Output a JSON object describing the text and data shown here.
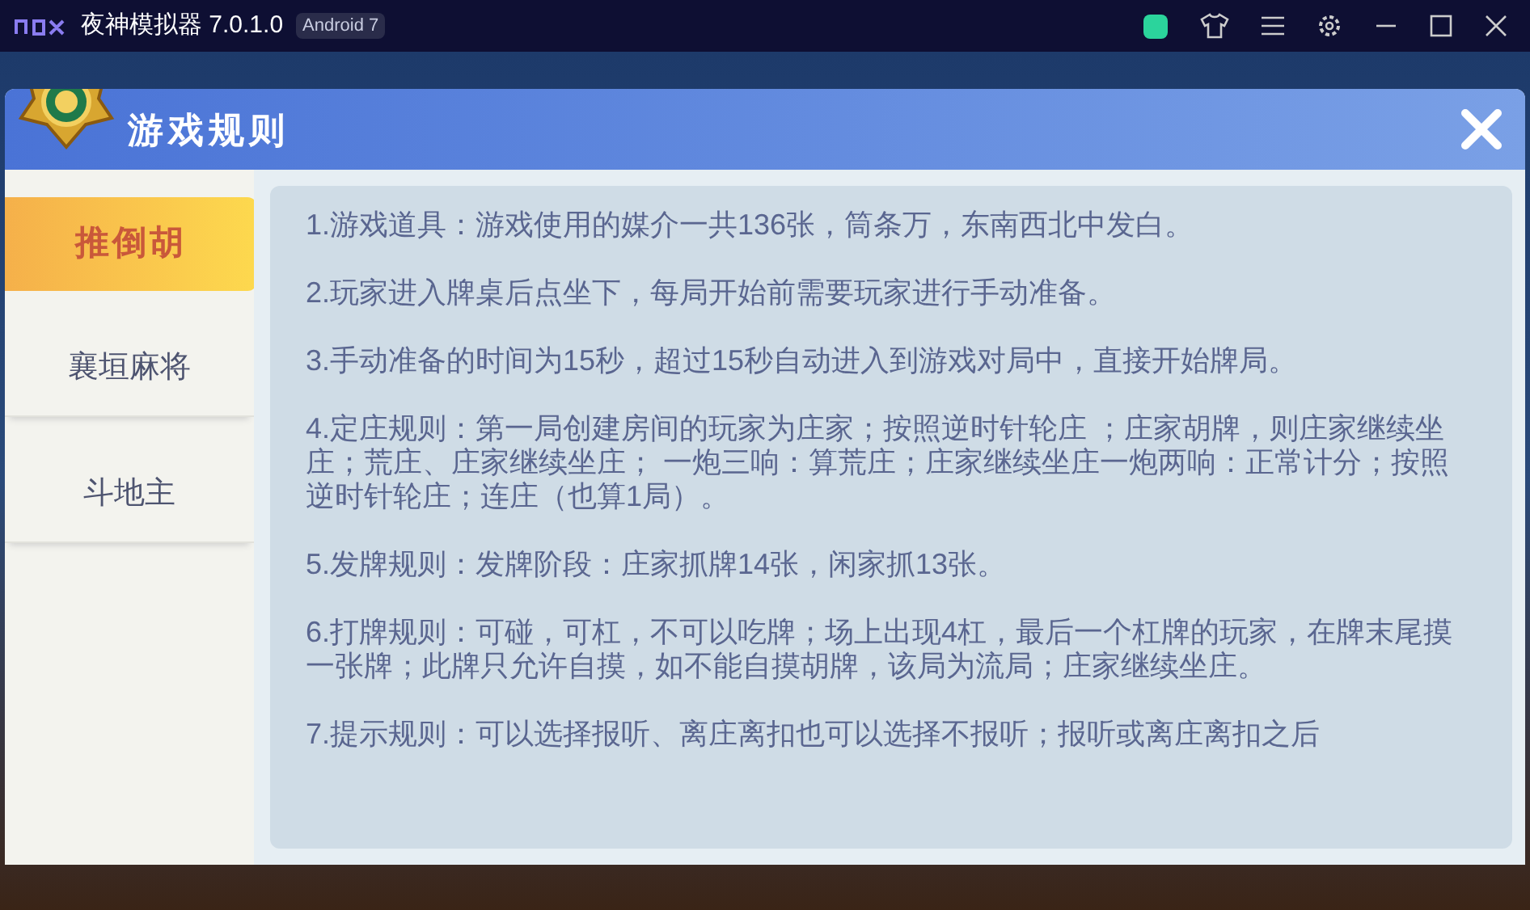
{
  "window": {
    "app_name": "夜神模拟器 7.0.1.0",
    "badge": "Android 7"
  },
  "dialog": {
    "title": "游戏规则"
  },
  "sidebar": {
    "items": [
      {
        "label": "推倒胡",
        "selected": true
      },
      {
        "label": "襄垣麻将",
        "selected": false
      },
      {
        "label": "斗地主",
        "selected": false
      }
    ]
  },
  "rules": [
    "1.游戏道具：游戏使用的媒介一共136张，筒条万，东南西北中发白。",
    "2.玩家进入牌桌后点坐下，每局开始前需要玩家进行手动准备。",
    "3.手动准备的时间为15秒，超过15秒自动进入到游戏对局中，直接开始牌局。",
    "4.定庄规则：第一局创建房间的玩家为庄家；按照逆时针轮庄 ；庄家胡牌，则庄家继续坐庄；荒庄、庄家继续坐庄；  一炮三响：算荒庄；庄家继续坐庄一炮两响：正常计分；按照逆时针轮庄；连庄（也算1局）。",
    "5.发牌规则：发牌阶段：庄家抓牌14张，闲家抓13张。",
    "6.打牌规则：可碰，可杠，不可以吃牌；场上出现4杠，最后一个杠牌的玩家，在牌末尾摸一张牌；此牌只允许自摸，如不能自摸胡牌，该局为流局；庄家继续坐庄。",
    "7.提示规则：可以选择报听、离庄离扣也可以选择不报听；报听或离庄离扣之后"
  ]
}
